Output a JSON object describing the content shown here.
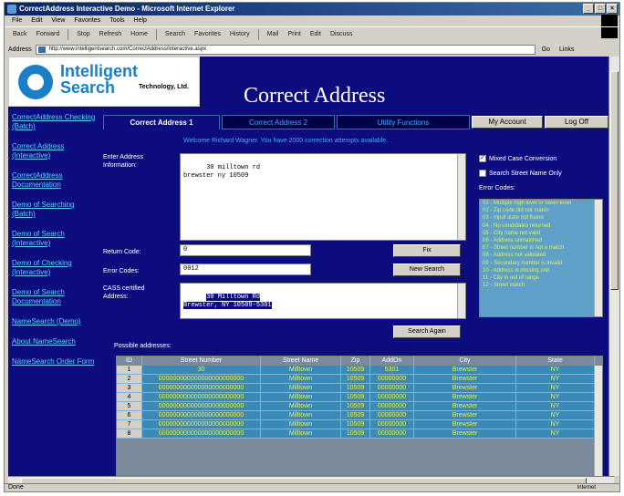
{
  "window": {
    "title": "CorrectAddress Interactive Demo - Microsoft Internet Explorer",
    "menu": [
      "File",
      "Edit",
      "View",
      "Favorites",
      "Tools",
      "Help"
    ],
    "toolbar": [
      "Back",
      "Forward",
      "Stop",
      "Refresh",
      "Home",
      "Search",
      "Favorites",
      "History",
      "Mail",
      "Print",
      "Edit",
      "Discuss"
    ],
    "address_label": "Address",
    "address_value": "http://www.intelligentsearch.com/CorrectAddress/interactive.aspx",
    "go_label": "Go",
    "links_label": "Links",
    "status_text": "Done",
    "status_zone": "Internet"
  },
  "header": {
    "logo_line1": "Intelligent",
    "logo_line2": "Search",
    "logo_sub": "Technology, Ltd.",
    "page_title": "Correct Address"
  },
  "leftnav": [
    "CorrectAddress Checking (Batch)",
    "Correct Address (Interactive)",
    "CorrectAddress Documentation",
    "Demo of Searching (Batch)",
    "Demo of Search (Interactive)",
    "Demo of Checking (Interactive)",
    "Demo of Search Documentation",
    "NameSearch (Demo)",
    "About NameSearch",
    "NameSearch Order Form"
  ],
  "tabs": {
    "tab1": "Correct Address 1",
    "tab2": "Correct Address 2",
    "tab3": "Utility Functions",
    "my_account": "My Account",
    "log_off": "Log Off"
  },
  "notice": "Welcome Richard Wagner. You have 2000 correction attempts available.",
  "form": {
    "enter_label": "Enter Address Information:",
    "enter_value": "30 milltown rd\nbrewster ny 10509",
    "return_label": "Return Code:",
    "return_value": "0",
    "error_label": "Error Codes:",
    "error_value": "0012",
    "cert_label": "CASS certified Address:",
    "cert_value": "30 Milltown Rd\nBrewster, NY 10509-5301",
    "fix_button": "Fix",
    "new_search_button": "New Search",
    "search_button": "Search Again"
  },
  "options": {
    "mixed_case": "Mixed Case Conversion",
    "street_name_only": "Search Street Name Only",
    "error_codes_label": "Error Codes:",
    "error_codes": [
      "01 - Multiple high level or lower-level",
      "02 - Zip code did not match",
      "03 - Input state not found",
      "04 - No candidates returned",
      "05 - City name not valid",
      "06 - Address unmatched",
      "07 - Street number is not a match",
      "08 - Address not validated",
      "09 - Secondary number is invalid",
      "10 - Address is missing unit",
      "11 - City in out of range",
      "12 - Street match"
    ]
  },
  "results": {
    "label": "Possible addresses:",
    "headers": [
      "ID",
      "Street Number",
      "Street Name",
      "Zip",
      "AddOn",
      "City",
      "State"
    ],
    "rows": [
      [
        "1",
        "30",
        "Milltown",
        "10509",
        "5301",
        "Brewster",
        "NY"
      ],
      [
        "2",
        "000000000000000000000000",
        "Milltown",
        "10509",
        "00000000",
        "Brewster",
        "NY"
      ],
      [
        "3",
        "000000000000000000000000",
        "Milltown",
        "10509",
        "00000000",
        "Brewster",
        "NY"
      ],
      [
        "4",
        "000000000000000000000000",
        "Milltown",
        "10509",
        "00000000",
        "Brewster",
        "NY"
      ],
      [
        "5",
        "000000000000000000000000",
        "Milltown",
        "10509",
        "00000000",
        "Brewster",
        "NY"
      ],
      [
        "6",
        "000000000000000000000000",
        "Milltown",
        "10509",
        "00000000",
        "Brewster",
        "NY"
      ],
      [
        "7",
        "000000000000000000000000",
        "Milltown",
        "10509",
        "00000000",
        "Brewster",
        "NY"
      ],
      [
        "8",
        "000000000000000000000000",
        "Milltown",
        "10509",
        "00000000",
        "Brewster",
        "NY"
      ]
    ]
  }
}
